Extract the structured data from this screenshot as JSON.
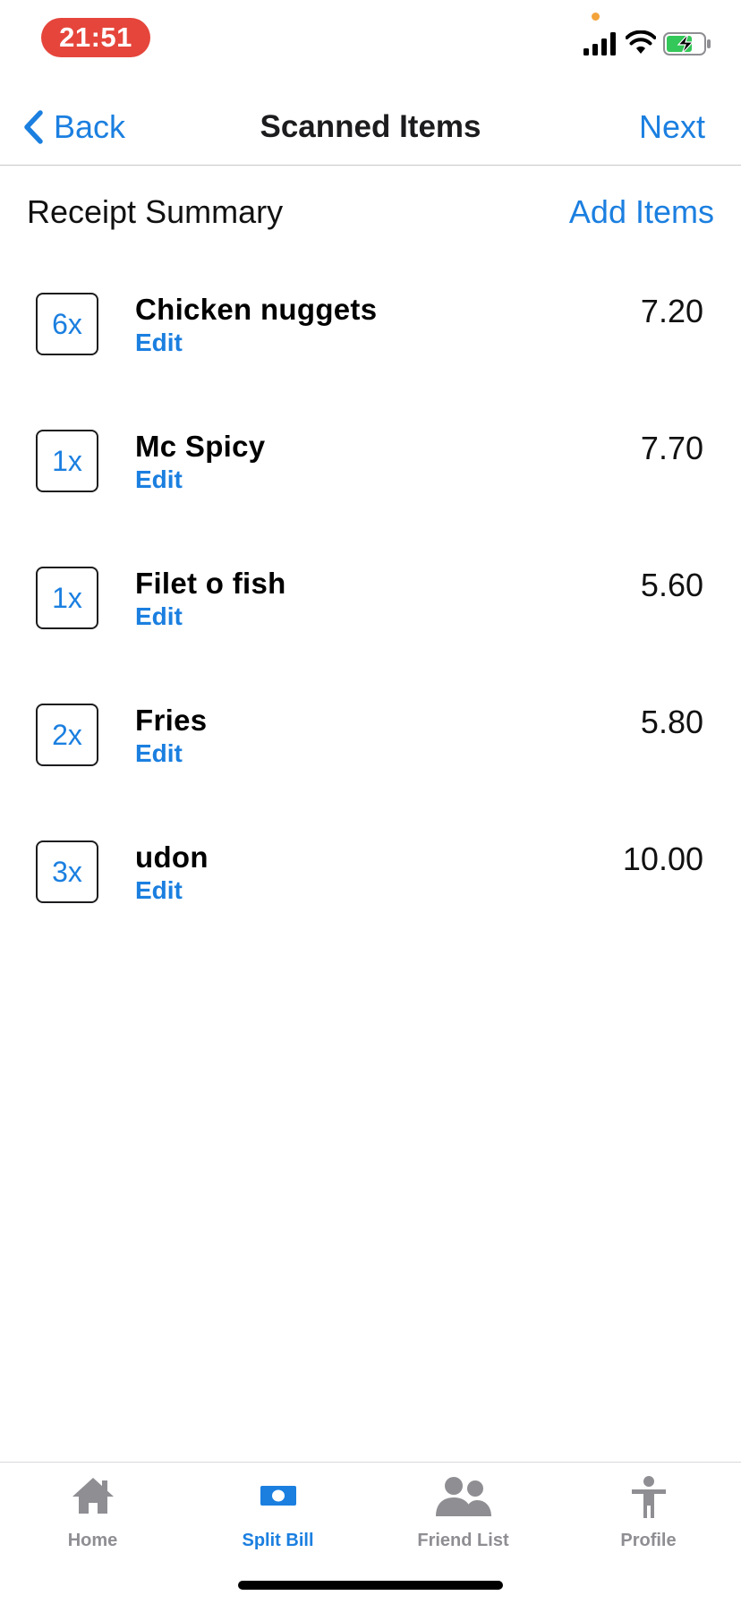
{
  "status_bar": {
    "time": "21:51",
    "time_pill_color": "#e5453b",
    "icons": [
      "signal-icon",
      "wifi-icon",
      "battery-charging-icon"
    ]
  },
  "nav": {
    "back_label": "Back",
    "title": "Scanned Items",
    "next_label": "Next",
    "accent_color": "#1b7fe0"
  },
  "summary": {
    "title": "Receipt Summary",
    "add_items_label": "Add Items"
  },
  "items": [
    {
      "qty": "6x",
      "name": "Chicken nuggets",
      "edit_label": "Edit",
      "price": "7.20"
    },
    {
      "qty": "1x",
      "name": "Mc Spicy",
      "edit_label": "Edit",
      "price": "7.70"
    },
    {
      "qty": "1x",
      "name": "Filet o fish",
      "edit_label": "Edit",
      "price": "5.60"
    },
    {
      "qty": "2x",
      "name": "Fries",
      "edit_label": "Edit",
      "price": "5.80"
    },
    {
      "qty": "3x",
      "name": "udon",
      "edit_label": "Edit",
      "price": "10.00"
    }
  ],
  "tab_bar": {
    "active_tab": "Split Bill",
    "tabs": [
      {
        "label": "Home",
        "icon": "home-icon"
      },
      {
        "label": "Split Bill",
        "icon": "money-bill-icon"
      },
      {
        "label": "Friend List",
        "icon": "users-icon"
      },
      {
        "label": "Profile",
        "icon": "person-icon"
      }
    ]
  }
}
